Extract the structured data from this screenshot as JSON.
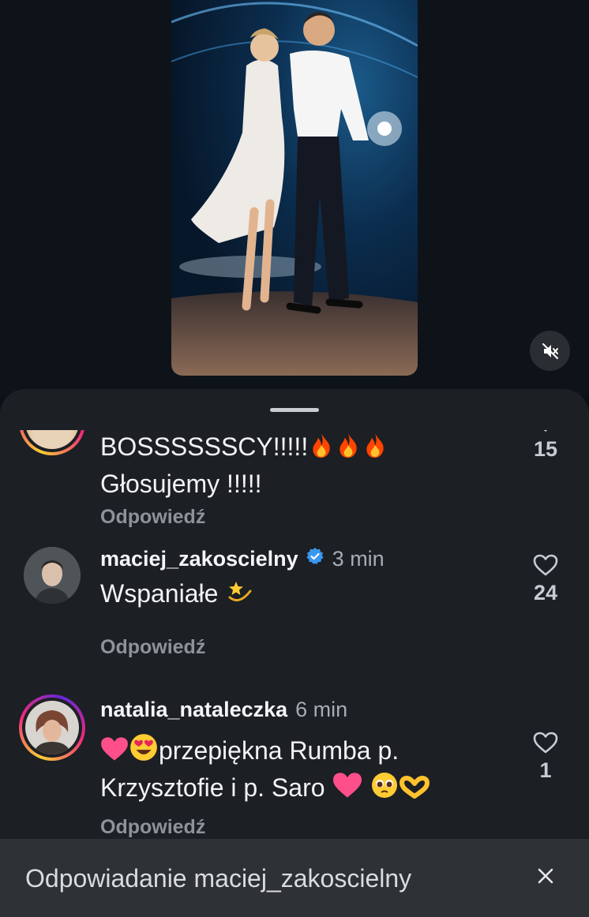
{
  "video": {
    "muted_icon": "speaker-muted-icon"
  },
  "comments": [
    {
      "username": "",
      "text_line1": "BOSSSSSSCY!!!!!",
      "text_line2": "Głosujemy !!!!!",
      "reply_label": "Odpowiedź",
      "likes": "15"
    },
    {
      "username": "maciej_zakoscielny",
      "verified": true,
      "time": "3 min",
      "text": "Wspaniałe",
      "reply_label": "Odpowiedź",
      "likes": "24"
    },
    {
      "username": "natalia_nataleczka",
      "time": "6 min",
      "text_line1": "przepiękna Rumba p.",
      "text_line2": "Krzysztofie i p. Saro",
      "reply_label": "Odpowiedź",
      "likes": "1"
    }
  ],
  "reply_bar": {
    "text": "Odpowiadanie maciej_zakoscielny"
  },
  "colors": {
    "accent_verified": "#3897f0",
    "sheet_bg": "#1c1f24",
    "reply_bar_bg": "#2e3136"
  }
}
